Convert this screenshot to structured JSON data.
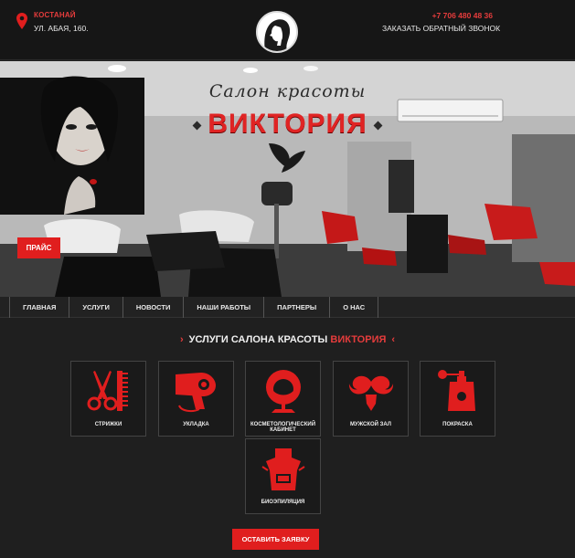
{
  "header": {
    "city": "КОСТАНАЙ",
    "address": "УЛ. АБАЯ, 160.",
    "phone": "+7 706 480 48 36",
    "callback": "ЗАКАЗАТЬ ОБРАТНЫЙ ЗВОНОК"
  },
  "hero": {
    "subtitle": "Салон красоты",
    "title": "ВИКТОРИЯ",
    "price_button": "ПРАЙС"
  },
  "nav": {
    "items": [
      "ГЛАВНАЯ",
      "УСЛУГИ",
      "НОВОСТИ",
      "НАШИ РАБОТЫ",
      "ПАРТНЕРЫ",
      "О НАС"
    ]
  },
  "services": {
    "title_prefix": "УСЛУГИ САЛОНА КРАСОТЫ",
    "title_accent": "ВИКТОРИЯ",
    "items": [
      {
        "label": "СТРИЖКИ",
        "icon": "scissors-comb-icon"
      },
      {
        "label": "УКЛАДКА",
        "icon": "hair-dryer-icon"
      },
      {
        "label": "КОСМЕТОЛОГИЧЕСКИЙ КАБИНЕТ",
        "icon": "beauty-chair-icon"
      },
      {
        "label": "МУЖСКОЙ ЗАЛ",
        "icon": "mustache-icon"
      },
      {
        "label": "ПОКРАСКА",
        "icon": "spray-bottle-icon"
      },
      {
        "label": "БИОЭПИЛЯЦИЯ",
        "icon": "apron-icon"
      }
    ],
    "cta": "ОСТАВИТЬ ЗАЯВКУ"
  },
  "colors": {
    "accent": "#e01e1e",
    "background": "#1f1f1f"
  }
}
